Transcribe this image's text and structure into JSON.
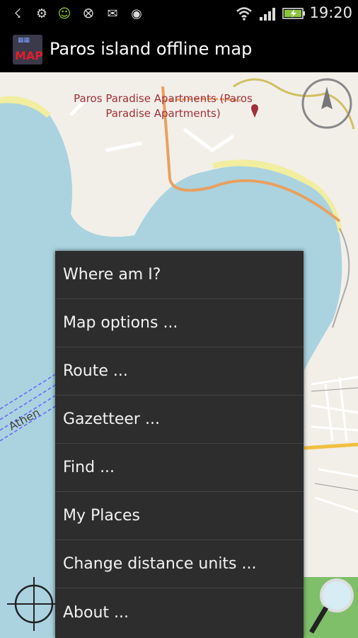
{
  "status_bar": {
    "time": "19:20",
    "icons": [
      "usb-icon",
      "android-debug-icon",
      "android-icon",
      "nfc-icon",
      "mail-icon",
      "spotify-icon",
      "wifi-icon",
      "signal-icon",
      "battery-charging-icon"
    ]
  },
  "app": {
    "title": "Paros island offline map",
    "icon_text": "MAP"
  },
  "map": {
    "poi_label": "Paros Paradise Apartments (Paros Paradise Apartments)",
    "road_label": "Athen",
    "colors": {
      "water": "#aad3df",
      "land": "#f2efe9",
      "beach": "#f2eea0",
      "road": "#e8a060",
      "ferry": "#6a6aff"
    }
  },
  "menu": {
    "items": [
      "Where am I?",
      "Map options ...",
      "Route ...",
      "Gazetteer ...",
      "Find ...",
      "My Places",
      "Change distance units ...",
      "About ..."
    ]
  }
}
